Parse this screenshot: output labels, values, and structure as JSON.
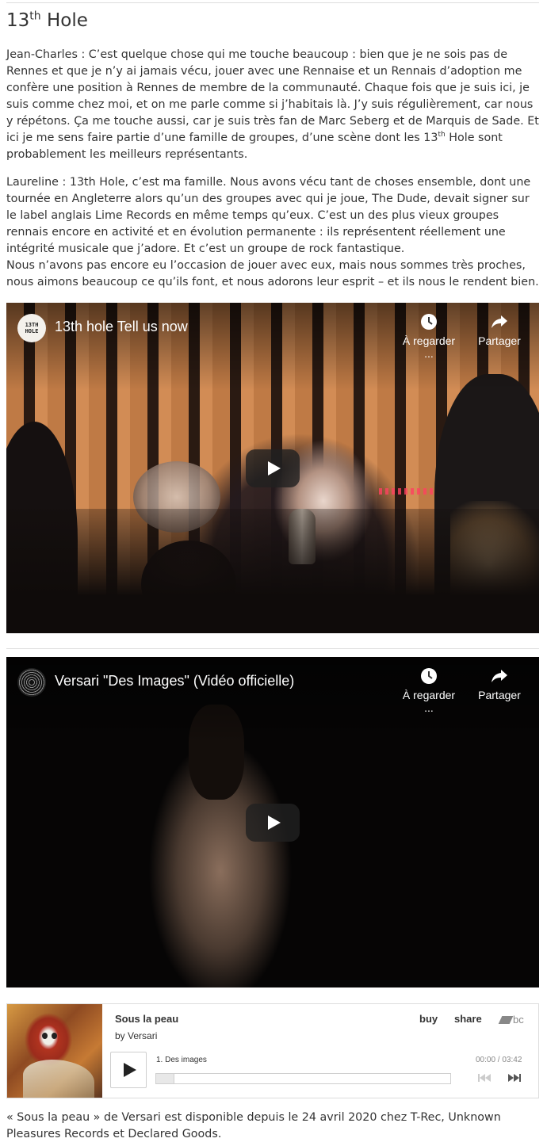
{
  "heading": {
    "base": "13",
    "sup": "th",
    "rest": " Hole"
  },
  "paragraph1": {
    "part1": "Jean-Charles : C’est quelque chose qui me touche beaucoup : bien que je ne sois pas de Rennes et que je n’y ai jamais vécu, jouer avec une Rennaise et un Rennais d’adoption me confère une position à Rennes de membre de la communauté. Chaque fois que je suis ici, je suis comme chez moi, et on me parle comme si j’habitais là. J’y suis régulièrement, car nous y répétons. Ça me touche aussi, car je suis très fan de Marc Seberg et de Marquis de Sade. Et ici je me sens faire partie d’une famille de groupes, d’une scène dont les 13",
    "sup": "th",
    "part2": " Hole sont probablement les meilleurs représentants."
  },
  "paragraph2": {
    "line1": "Laureline : 13th Hole, c’est ma famille. Nous avons vécu tant de choses ensemble, dont une tournée en Angleterre alors qu’un des groupes avec qui je joue, The Dude, devait signer sur le label anglais Lime Records en même temps qu’eux. C’est un des plus vieux groupes rennais encore en activité et en évolution permanente : ils représentent réellement une intégrité musicale que j’adore. Et c’est un groupe de rock fantastique.",
    "line2": "Nous n’avons pas encore eu l’occasion de jouer avec eux, mais nous sommes très proches, nous aimons beaucoup ce qu’ils font, et nous adorons leur esprit – et ils nous le rendent bien."
  },
  "video1": {
    "title": "13th hole Tell us now",
    "channel_logo": "13TH HOLE",
    "watch_later": "À regarder ...",
    "share": "Partager"
  },
  "video2": {
    "title": "Versari \"Des Images\" (Vidéo officielle)",
    "watch_later": "À regarder ...",
    "share": "Partager"
  },
  "bandcamp": {
    "album": "Sous la peau",
    "by": "by",
    "artist": "Versari",
    "buy": "buy",
    "share": "share",
    "logo_text": "bc",
    "track": "1.  Des images",
    "time_current": "00:00",
    "time_sep": " / ",
    "time_total": "03:42",
    "progress": 0
  },
  "caption": "« Sous la peau » de Versari est disponible depuis le 24 avril 2020 chez T-Rec, Unknown Pleasures Records et Declared Goods."
}
